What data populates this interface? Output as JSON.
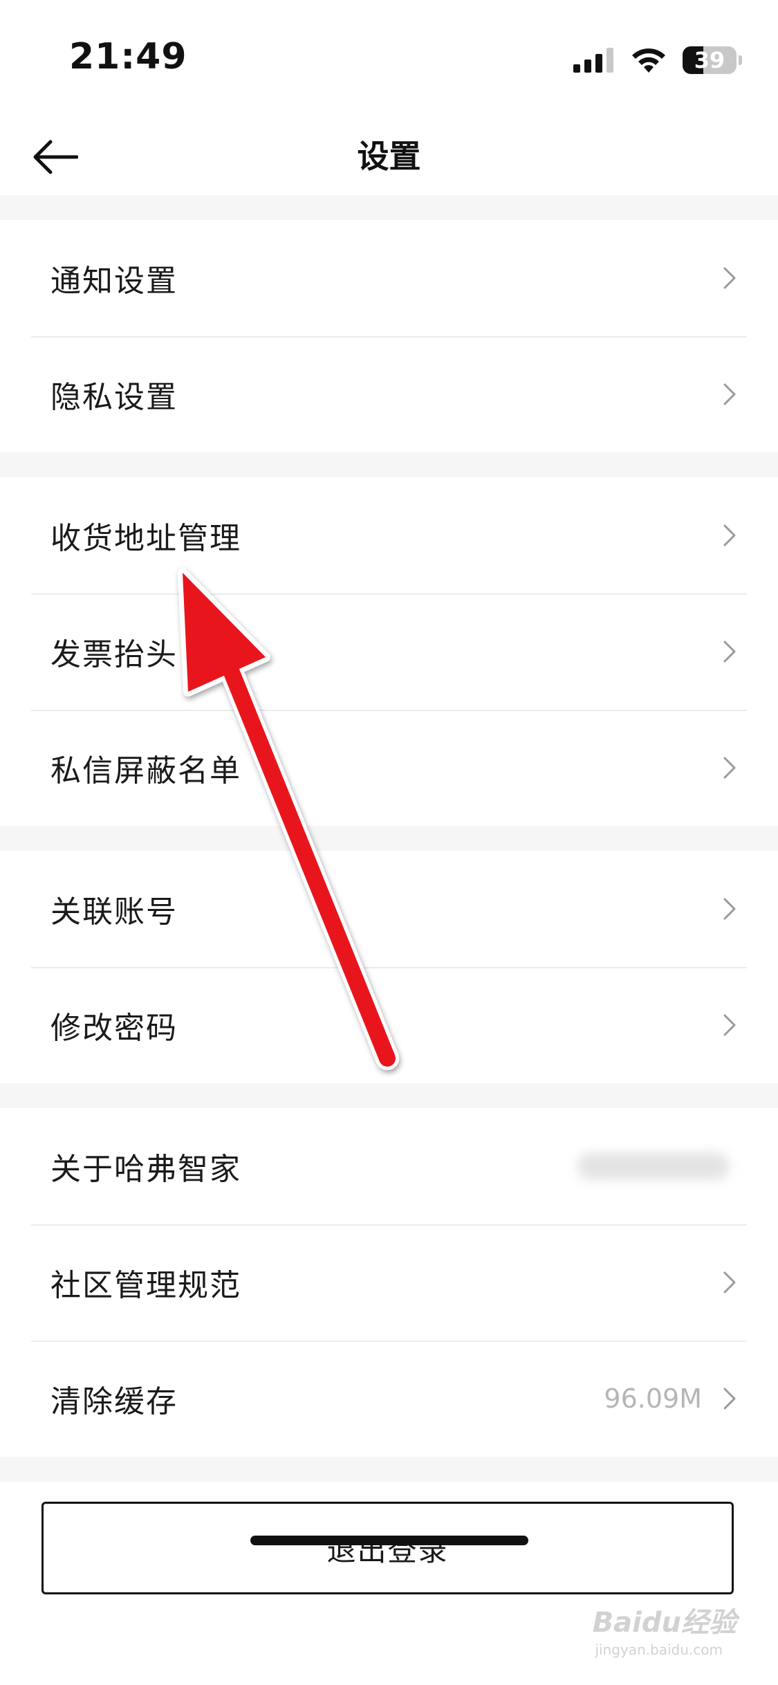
{
  "status_bar": {
    "time": "21:49",
    "battery": "39",
    "battery_level_percent": 39,
    "icons": [
      "cellular-signal-icon",
      "wifi-icon",
      "battery-icon"
    ]
  },
  "nav": {
    "title": "设置",
    "back_icon": "back-arrow-icon"
  },
  "groups": [
    {
      "items": [
        {
          "label": "通知设置",
          "icon": "chevron-right-icon"
        },
        {
          "label": "隐私设置",
          "icon": "chevron-right-icon"
        }
      ]
    },
    {
      "items": [
        {
          "label": "收货地址管理",
          "icon": "chevron-right-icon"
        },
        {
          "label": "发票抬头",
          "icon": "chevron-right-icon"
        },
        {
          "label": "私信屏蔽名单",
          "icon": "chevron-right-icon"
        }
      ]
    },
    {
      "items": [
        {
          "label": "关联账号",
          "icon": "chevron-right-icon"
        },
        {
          "label": "修改密码",
          "icon": "chevron-right-icon"
        }
      ]
    },
    {
      "items": [
        {
          "label": "关于哈弗智家"
        },
        {
          "label": "社区管理规范",
          "icon": "chevron-right-icon"
        },
        {
          "label": "清除缓存",
          "value": "96.09M",
          "icon": "chevron-right-icon"
        }
      ]
    }
  ],
  "logout": {
    "label": "退出登录"
  },
  "watermark": {
    "text": "Baidu经验",
    "sub": "jingyan.baidu.com"
  },
  "colors": {
    "background": "#f6f6f6",
    "card": "#ffffff",
    "annotation_arrow": "#e8121e",
    "muted_text": "#b5b5b5"
  }
}
